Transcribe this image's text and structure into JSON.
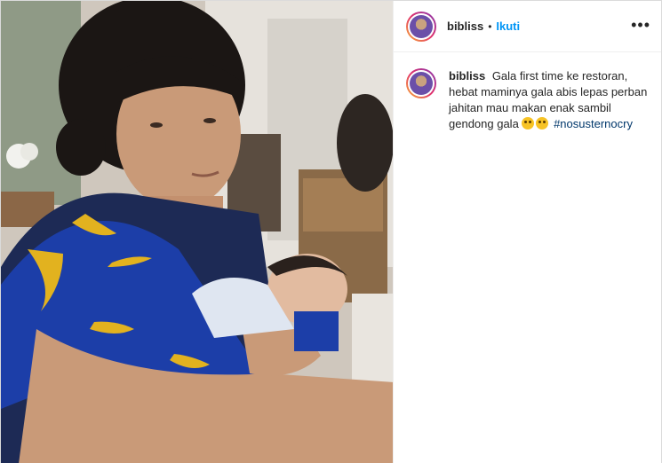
{
  "post": {
    "username": "bibliss",
    "separator": "•",
    "follow_label": "Ikuti",
    "more_label": "•••"
  },
  "caption": {
    "username": "bibliss",
    "text": "Gala first time ke restoran, hebat maminya gala abis lepas perban jahitan mau makan enak sambil gendong gala",
    "emojis": [
      "crying-face-emoji",
      "crying-face-emoji"
    ],
    "hashtag": "#nosusternocry"
  },
  "media": {
    "description_icon": "photo"
  }
}
